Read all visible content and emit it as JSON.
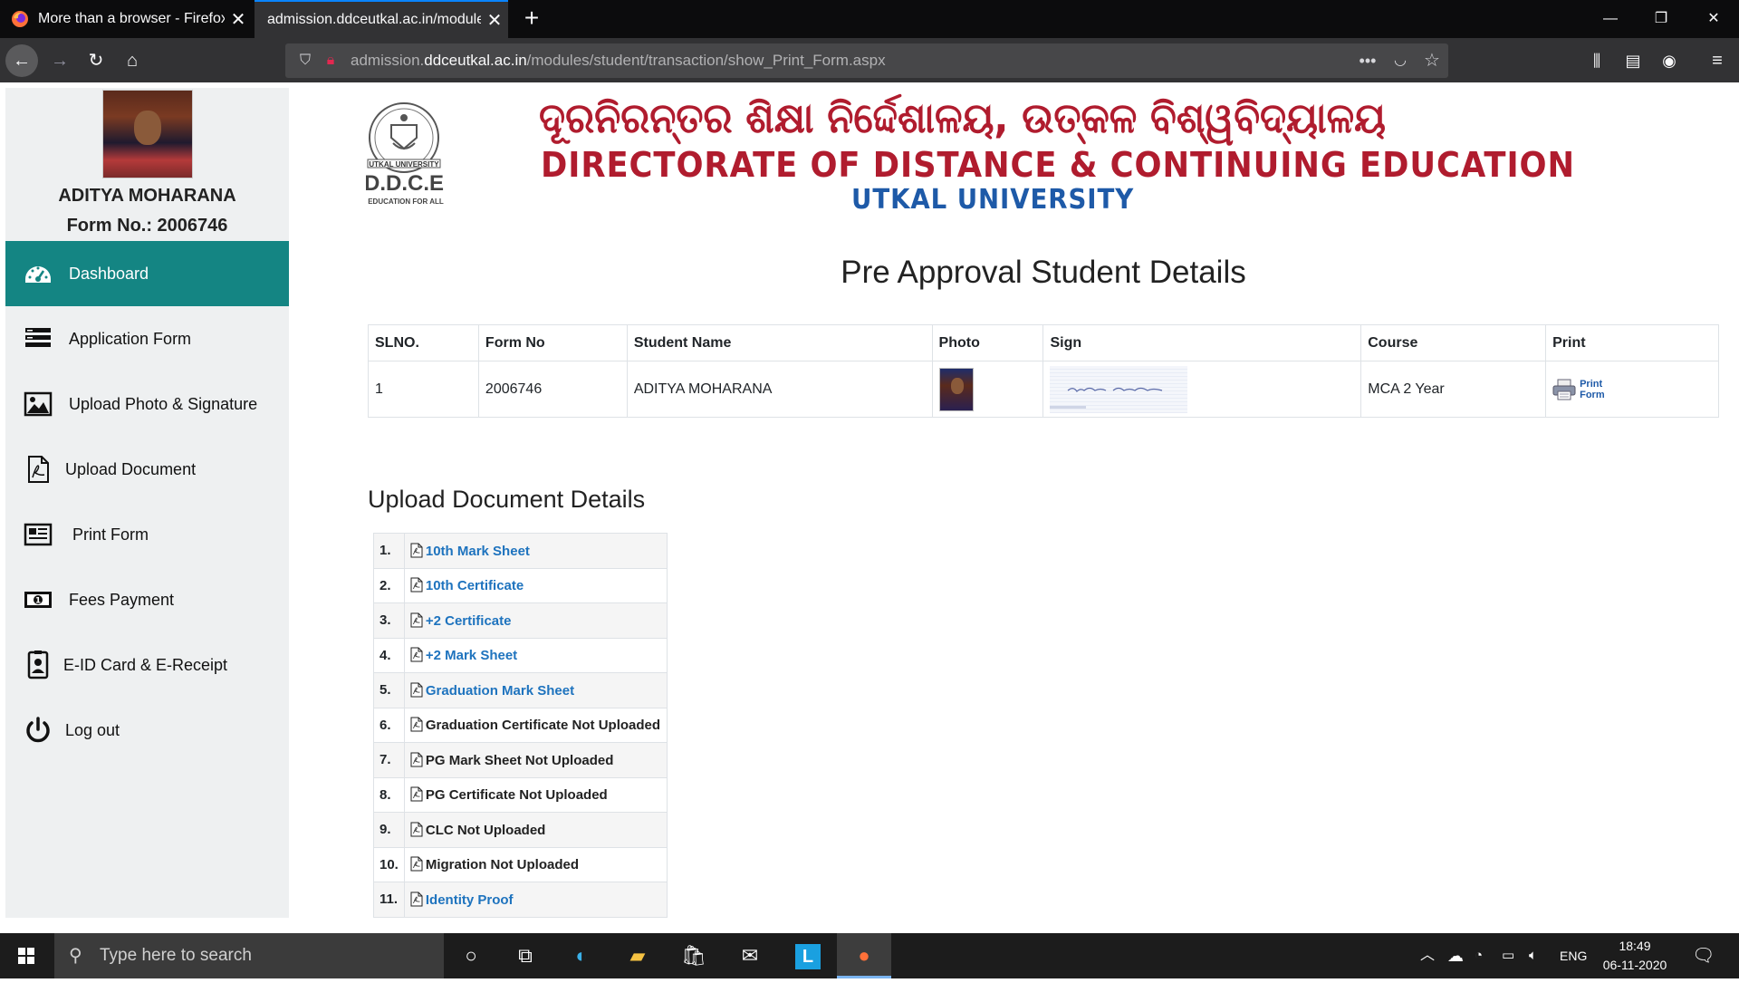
{
  "browser": {
    "tabs": [
      {
        "label": "More than a browser - Firefox P"
      },
      {
        "label": "admission.ddceutkal.ac.in/modules/"
      }
    ],
    "url": {
      "prefix": "admission.",
      "domain": "ddceutkal.ac.in",
      "path": "/modules/student/transaction/show_Print_Form.aspx"
    },
    "icons": [
      "firefox-icon",
      "close-icon",
      "new-tab-icon",
      "minimize-icon",
      "restore-icon",
      "close-window-icon",
      "back-icon",
      "forward-icon",
      "reload-icon",
      "home-icon",
      "shield-icon",
      "insecure-lock-icon",
      "more-icon",
      "pocket-icon",
      "bookmark-star-icon",
      "library-icon",
      "sidebar-icon",
      "account-icon",
      "menu-icon"
    ]
  },
  "sidebar": {
    "student_name": "ADITYA MOHARANA",
    "form_no": "Form No.: 2006746",
    "items": [
      {
        "label": "Dashboard",
        "icon": "dashboard-icon",
        "active": true
      },
      {
        "label": "Application Form",
        "icon": "form-icon"
      },
      {
        "label": "Upload Photo & Signature",
        "icon": "image-icon"
      },
      {
        "label": "Upload Document",
        "icon": "pdf-document-icon"
      },
      {
        "label": "Print Form",
        "icon": "newspaper-icon"
      },
      {
        "label": "Fees Payment",
        "icon": "money-icon"
      },
      {
        "label": "E-ID Card & E-Receipt",
        "icon": "id-card-icon"
      },
      {
        "label": "Log out",
        "icon": "power-icon"
      }
    ]
  },
  "header": {
    "logo_top": "UTKAL UNIVERSITY",
    "logo_main": "D.D.C.E",
    "logo_tagline": "EDUCATION FOR ALL",
    "banner_odia": "ଦୂରନିରନ୍ତର ଶିକ୍ଷା ନିର୍ଦ୍ଦେଶାଳୟ, ଉତ୍କଳ ବିଶ୍ୱବିଦ୍ୟାଳୟ",
    "banner_english": "DIRECTORATE OF DISTANCE & CONTINUING EDUCATION",
    "banner_university": "UTKAL UNIVERSITY"
  },
  "main": {
    "title": "Pre Approval Student Details",
    "table": {
      "headers": [
        "SLNO.",
        "Form No",
        "Student Name",
        "Photo",
        "Sign",
        "Course",
        "Print"
      ],
      "row": {
        "slno": "1",
        "form_no": "2006746",
        "student_name": "ADITYA MOHARANA",
        "course": "MCA 2 Year",
        "print_line1": "Print",
        "print_line2": "Form"
      }
    },
    "documents_title": "Upload Document Details",
    "documents": [
      {
        "num": "1.",
        "name": "10th Mark Sheet",
        "uploaded": true
      },
      {
        "num": "2.",
        "name": "10th Certificate",
        "uploaded": true
      },
      {
        "num": "3.",
        "name": "+2 Certificate",
        "uploaded": true
      },
      {
        "num": "4.",
        "name": "+2 Mark Sheet",
        "uploaded": true
      },
      {
        "num": "5.",
        "name": "Graduation Mark Sheet",
        "uploaded": true
      },
      {
        "num": "6.",
        "name": "Graduation Certificate Not Uploaded",
        "uploaded": false
      },
      {
        "num": "7.",
        "name": "PG Mark Sheet Not Uploaded",
        "uploaded": false
      },
      {
        "num": "8.",
        "name": "PG Certificate Not Uploaded",
        "uploaded": false
      },
      {
        "num": "9.",
        "name": "CLC Not Uploaded",
        "uploaded": false
      },
      {
        "num": "10.",
        "name": "Migration Not Uploaded",
        "uploaded": false
      },
      {
        "num": "11.",
        "name": "Identity Proof",
        "uploaded": true
      }
    ]
  },
  "taskbar": {
    "search_placeholder": "Type here to search",
    "language": "ENG",
    "time": "18:49",
    "date": "06-11-2020"
  },
  "colors": {
    "accent": "#148583",
    "banner_red": "#b01c2e",
    "banner_blue": "#1e5aa8",
    "link": "#1e73be"
  }
}
